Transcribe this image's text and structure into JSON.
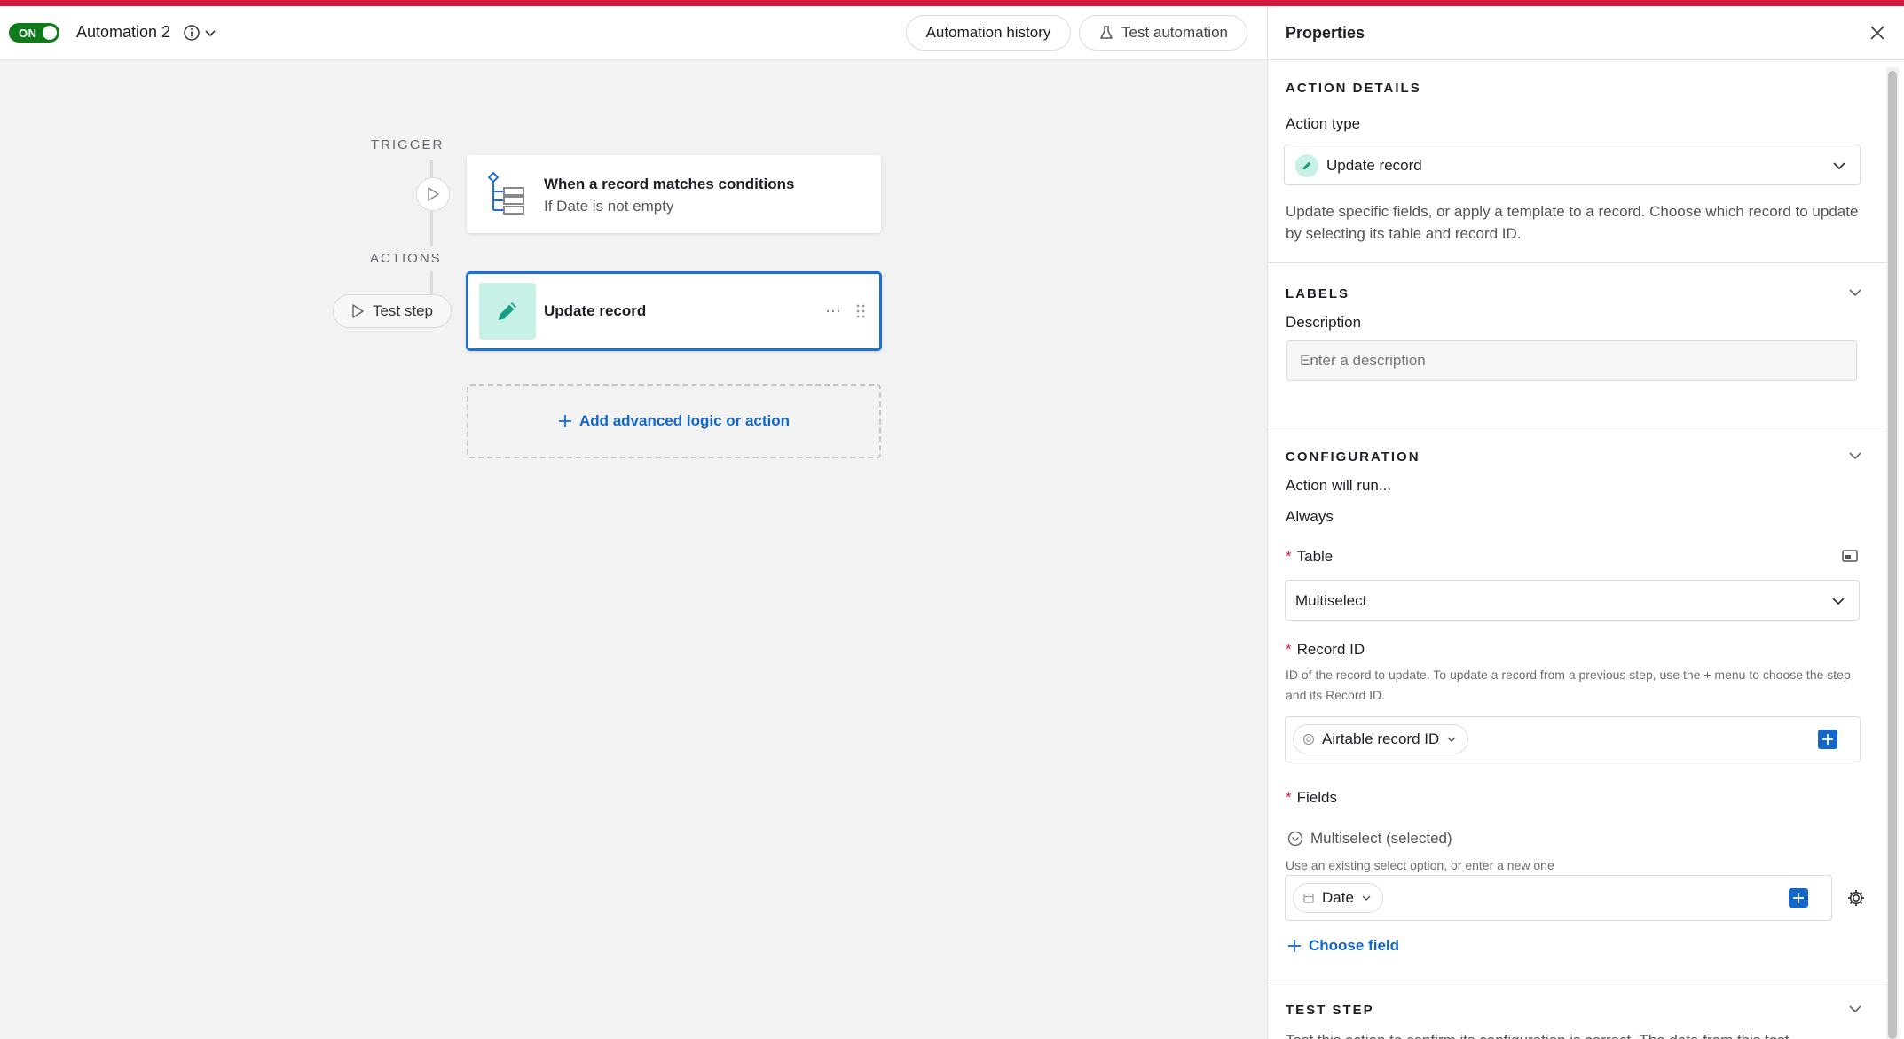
{
  "header": {
    "toggle_label": "ON",
    "automation_name": "Automation 2",
    "history_button": "Automation history",
    "test_button": "Test automation"
  },
  "canvas": {
    "trigger_label": "TRIGGER",
    "actions_label": "ACTIONS",
    "trigger_card": {
      "title": "When a record matches conditions",
      "subtitle": "If Date is not empty"
    },
    "action_card": {
      "title": "Update record",
      "more_label": "···"
    },
    "test_step_button": "Test step",
    "add_button": "Add advanced logic or action"
  },
  "panel": {
    "title": "Properties",
    "action_details": {
      "section_label": "ACTION DETAILS",
      "action_type_label": "Action type",
      "action_type_value": "Update record",
      "description": "Update specific fields, or apply a template to a record. Choose which record to update by selecting its table and record ID."
    },
    "labels": {
      "section_label": "LABELS",
      "description_label": "Description",
      "description_placeholder": "Enter a description"
    },
    "configuration": {
      "section_label": "CONFIGURATION",
      "run_label": "Action will run...",
      "run_value": "Always",
      "table_label": "Table",
      "table_value": "Multiselect",
      "record_id_label": "Record ID",
      "record_id_help": "ID of the record to update. To update a record from a previous step, use the + menu to choose the step and its Record ID.",
      "record_id_token": "Airtable record ID",
      "fields_label": "Fields",
      "field_name": "Multiselect (selected)",
      "field_help": "Use an existing select option, or enter a new one",
      "field_token": "Date",
      "choose_field": "Choose field"
    },
    "test_step": {
      "section_label": "TEST STEP",
      "text": "Test this action to confirm its configuration is correct. The data from this test"
    }
  },
  "colors": {
    "brand_stripe": "#d8193f",
    "toggle_on": "#0f7a1a",
    "accent_blue": "#1466c9",
    "selection_border": "#1d6fd8",
    "action_icon_bg": "#c7f1e6",
    "action_icon_fg": "#1a9c84"
  },
  "icons": [
    "info-icon",
    "chevron-down-icon",
    "flask-icon",
    "play-icon",
    "conditions-icon",
    "pencil-icon",
    "more-icon",
    "drag-handle-icon",
    "plus-icon",
    "close-icon",
    "expand-icon",
    "at-sign-icon",
    "calendar-icon",
    "gear-icon",
    "circle-chevron-icon"
  ]
}
